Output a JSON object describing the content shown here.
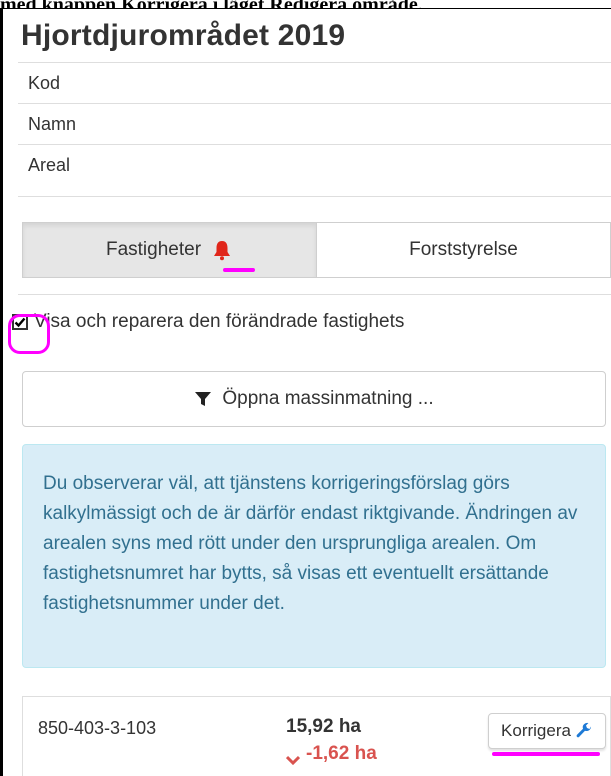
{
  "page": {
    "cut_heading": "med knappen Korrigera i läget Redigera område.",
    "title": "Hjortdjurområdet 2019"
  },
  "info_rows": [
    "Kod",
    "Namn",
    "Areal"
  ],
  "tabs": [
    {
      "label": "Fastigheter",
      "active": true,
      "icon": "bell-icon"
    },
    {
      "label": "Forststyrelse",
      "active": false
    }
  ],
  "checkbox": {
    "label": "Visa och reparera den förändrade fastighets",
    "checked": true
  },
  "mass_button": {
    "label": "Öppna massinmatning ...",
    "icon": "filter-icon"
  },
  "alert": {
    "text": "Du observerar väl, att tjänstens korrigeringsförslag görs kalkylmässigt och de är därför endast riktgivande. Ändringen av arealen syns med rött under den ursprungliga arealen. Om fastighetsnumret har bytts, så visas ett eventuellt ersättande fastighetsnummer under det."
  },
  "property_row": {
    "code": "850-403-3-103",
    "area": "15,92 ha",
    "change": "-1,62 ha",
    "button": "Korrigera",
    "button_icon": "wrench-icon"
  },
  "colors": {
    "highlight": "#ff00ff",
    "alert_text": "#31708f",
    "alert_bg": "#d9edf7",
    "bell": "#e0261a",
    "negative": "#d9534f",
    "wrench": "#1e7ad6"
  }
}
